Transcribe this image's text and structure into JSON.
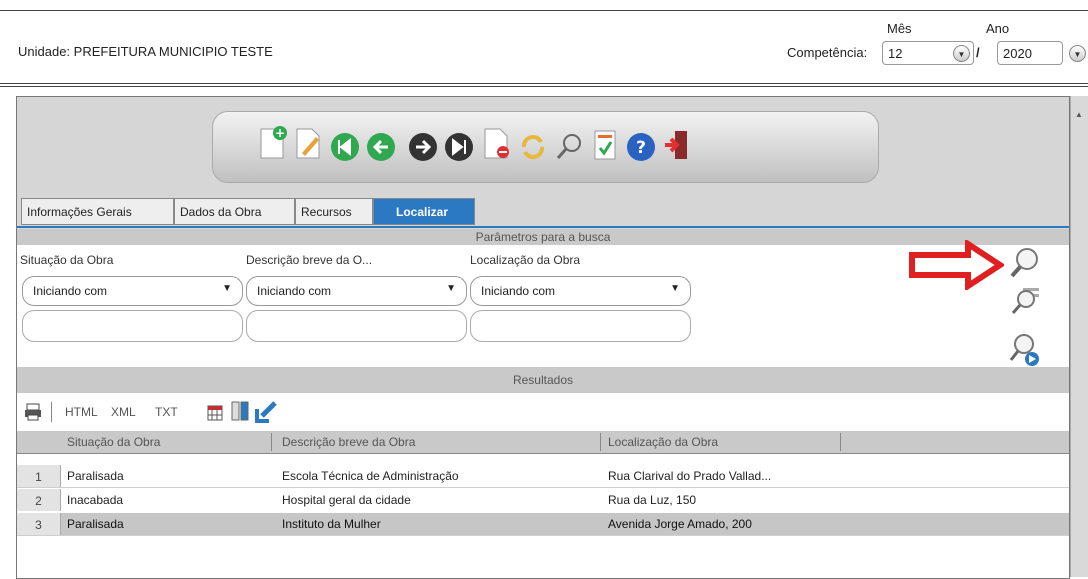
{
  "header": {
    "unidade": "Unidade: PREFEITURA MUNICIPIO TESTE",
    "mes_label": "Mês",
    "ano_label": "Ano",
    "competencia_label": "Competência:",
    "mes_value": "12",
    "ano_value": "2020",
    "separator": "/"
  },
  "toolbar": {
    "icons": [
      "add-document-icon",
      "edit-icon",
      "first-record-icon",
      "previous-record-icon",
      "next-record-icon",
      "last-record-icon",
      "delete-document-icon",
      "refresh-icon",
      "search-icon",
      "report-icon",
      "help-icon",
      "exit-icon"
    ]
  },
  "tabs": [
    "Informações Gerais",
    "Dados da Obra",
    "Recursos",
    "Localizar"
  ],
  "params": {
    "title": "Parâmetros para a busca",
    "columns": [
      {
        "label": "Situação da Obra",
        "operator": "Iniciando com",
        "value": ""
      },
      {
        "label": "Descrição breve da O...",
        "operator": "Iniciando com",
        "value": ""
      },
      {
        "label": "Localização da Obra",
        "operator": "Iniciando com",
        "value": ""
      }
    ]
  },
  "results": {
    "title": "Resultados",
    "export": [
      "HTML",
      "XML",
      "TXT"
    ],
    "headers": [
      "Situação da Obra",
      "Descrição breve da Obra",
      "Localização da Obra"
    ],
    "rows": [
      {
        "num": "1",
        "situacao": "Paralisada",
        "descricao": "Escola Técnica de Administração",
        "localizacao": "Rua Clarival do Prado Vallad..."
      },
      {
        "num": "2",
        "situacao": "Inacabada",
        "descricao": "Hospital geral da cidade",
        "localizacao": "Rua da Luz, 150"
      },
      {
        "num": "3",
        "situacao": "Paralisada",
        "descricao": "Instituto da Mulher",
        "localizacao": "Avenida Jorge Amado, 200"
      }
    ]
  },
  "colors": {
    "accent": "#2a79c2",
    "highlight_arrow": "#e02020",
    "selected_row": "#c6c6c6"
  }
}
